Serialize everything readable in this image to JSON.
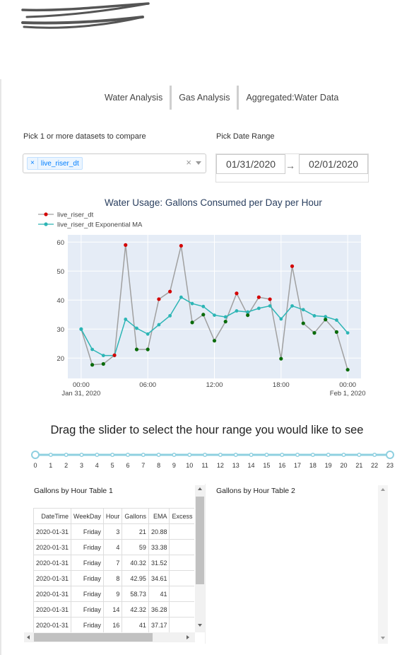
{
  "tabs": [
    "Water Analysis",
    "Gas Analysis",
    "Aggregated:Water Data"
  ],
  "datasets": {
    "label": "Pick 1 or more datasets to compare",
    "selected": "live_riser_dt",
    "remove_glyph": "×",
    "clear_glyph": "×"
  },
  "date_range": {
    "label": "Pick Date Range",
    "start": "01/31/2020",
    "end": "02/01/2020",
    "arrow": "→"
  },
  "chart_data": {
    "type": "line",
    "title": "Water Usage: Gallons Consumed per Day per Hour",
    "xlabel": "",
    "ylabel": "",
    "x_unit": "hours since 2020-01-31 00:00",
    "x_ticks": [
      {
        "x": 0,
        "line1": "00:00",
        "line2": "Jan 31, 2020"
      },
      {
        "x": 6,
        "line1": "06:00",
        "line2": ""
      },
      {
        "x": 12,
        "line1": "12:00",
        "line2": ""
      },
      {
        "x": 18,
        "line1": "18:00",
        "line2": ""
      },
      {
        "x": 24,
        "line1": "00:00",
        "line2": "Feb 1, 2020"
      }
    ],
    "y_ticks": [
      20,
      30,
      40,
      50,
      60
    ],
    "xlim": [
      -1.2,
      25.2
    ],
    "ylim": [
      13,
      62.5
    ],
    "grid": true,
    "legend": "top-left",
    "series": [
      {
        "name": "live_riser_dt",
        "color": "#a0a0a0",
        "x": [
          0,
          1,
          2,
          3,
          4,
          5,
          6,
          7,
          8,
          9,
          10,
          11,
          12,
          13,
          14,
          15,
          16,
          17,
          18,
          19,
          20,
          21,
          22,
          23,
          24
        ],
        "values": [
          30,
          17.7,
          18,
          21,
          59,
          23,
          23,
          40.32,
          42.95,
          58.73,
          32.3,
          35,
          26,
          32.6,
          42.32,
          34.8,
          41,
          40.3,
          19.8,
          51.7,
          32,
          28.7,
          33.3,
          29,
          16
        ]
      },
      {
        "name": "live_riser_dt Exponential MA",
        "color": "#2cb5b5",
        "x": [
          0,
          1,
          2,
          3,
          4,
          5,
          6,
          7,
          8,
          9,
          10,
          11,
          12,
          13,
          14,
          15,
          16,
          17,
          18,
          19,
          20,
          21,
          22,
          23,
          24
        ],
        "values": [
          30,
          23,
          20.9,
          20.88,
          33.38,
          30.3,
          28.3,
          31.52,
          34.61,
          41,
          38.8,
          37.8,
          34.8,
          34.2,
          36.28,
          35.9,
          37.17,
          38,
          33.5,
          38,
          36.7,
          34.6,
          34.3,
          33.1,
          28.7
        ]
      }
    ],
    "marker_colors": {
      "above": "#d40000",
      "below": "#0a6b0a",
      "start": "#2cb5b5"
    }
  },
  "slider": {
    "title": "Drag the slider to select the hour range you would like to see",
    "min": 0,
    "max": 23,
    "range": [
      0,
      23
    ],
    "ticks": [
      "0",
      "1",
      "2",
      "3",
      "4",
      "5",
      "6",
      "7",
      "8",
      "9",
      "10",
      "11",
      "12",
      "13",
      "14",
      "15",
      "16",
      "17",
      "18",
      "19",
      "20",
      "21",
      "22",
      "23"
    ],
    "color": "#8fd0e0"
  },
  "table1": {
    "title": "Gallons by Hour Table 1",
    "columns": [
      "DateTime",
      "WeekDay",
      "Hour",
      "Gallons",
      "EMA",
      "Excess Exp"
    ],
    "rows": [
      [
        "2020-01-31",
        "Friday",
        "3",
        "21",
        "20.88",
        ""
      ],
      [
        "2020-01-31",
        "Friday",
        "4",
        "59",
        "33.38",
        ""
      ],
      [
        "2020-01-31",
        "Friday",
        "7",
        "40.32",
        "31.52",
        ""
      ],
      [
        "2020-01-31",
        "Friday",
        "8",
        "42.95",
        "34.61",
        ""
      ],
      [
        "2020-01-31",
        "Friday",
        "9",
        "58.73",
        "41",
        ""
      ],
      [
        "2020-01-31",
        "Friday",
        "14",
        "42.32",
        "36.28",
        ""
      ],
      [
        "2020-01-31",
        "Friday",
        "16",
        "41",
        "37.17",
        ""
      ]
    ]
  },
  "table2": {
    "title": "Gallons by Hour Table 2"
  }
}
